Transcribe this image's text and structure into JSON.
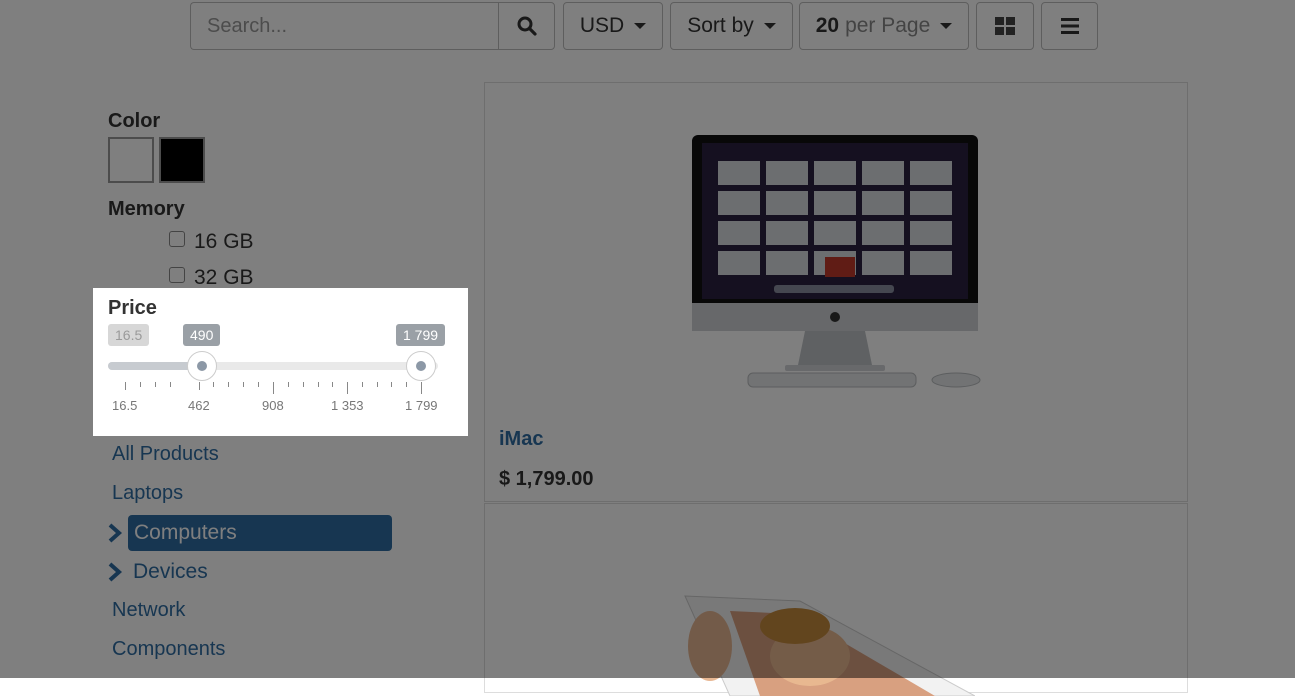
{
  "toolbar": {
    "search_placeholder": "Search...",
    "currency_label": "USD",
    "sort_label": "Sort by",
    "per_page_count": "20",
    "per_page_suffix": "per Page"
  },
  "filters": {
    "color_title": "Color",
    "memory_title": "Memory",
    "memory_options": [
      "16 GB",
      "32 GB"
    ],
    "price_title": "Price",
    "price_slider": {
      "min_label": "16.5",
      "lower_value": "490",
      "upper_value": "1 799",
      "grid_labels": [
        "16.5",
        "462",
        "908",
        "1 353",
        "1 799"
      ],
      "range_min": 16.5,
      "range_max": 1799,
      "lower": 490,
      "upper": 1799
    }
  },
  "categories": {
    "all": "All Products",
    "laptops": "Laptops",
    "computers": "Computers",
    "devices": "Devices",
    "network": "Network",
    "components": "Components"
  },
  "products": [
    {
      "name": "iMac",
      "price": "$ 1,799.00"
    }
  ],
  "colors": {
    "accent": "#2f6da3",
    "overlay": "rgba(0,0,0,0.5)"
  }
}
